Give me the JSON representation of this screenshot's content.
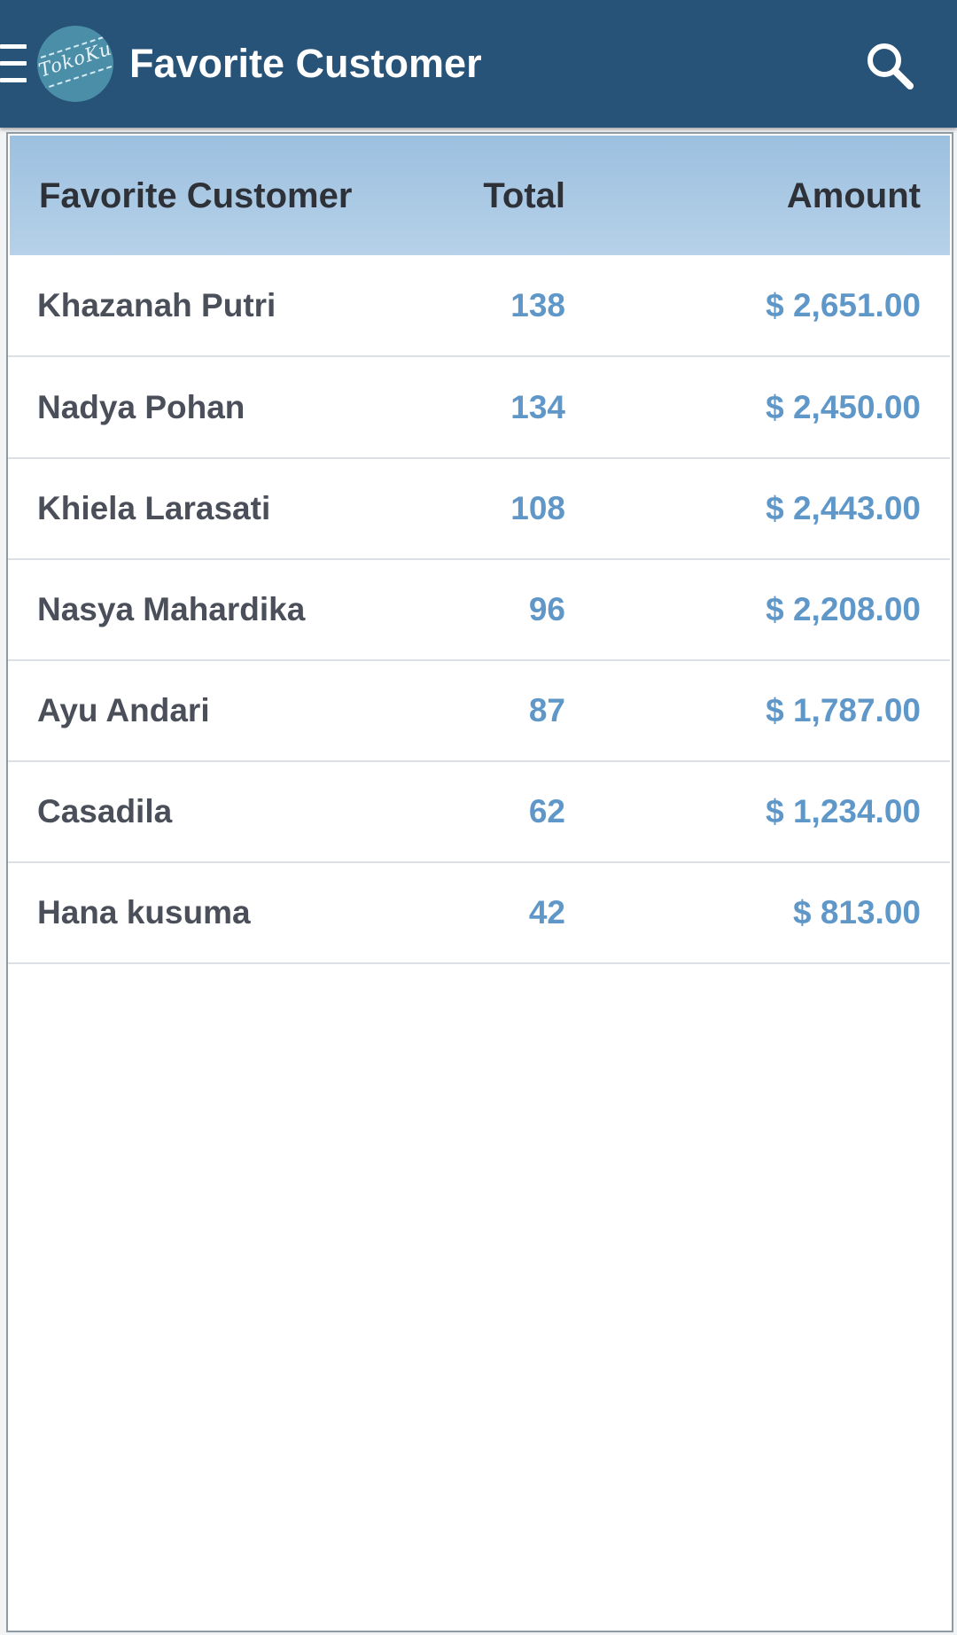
{
  "appbar": {
    "title": "Favorite Customer",
    "logo_text": "TokoKu",
    "icons": {
      "menu": "menu-icon",
      "search": "search-icon"
    }
  },
  "table": {
    "headers": {
      "name": "Favorite Customer",
      "total": "Total",
      "amount": "Amount"
    },
    "rows": [
      {
        "name": "Khazanah Putri",
        "total": "138",
        "amount": "$ 2,651.00"
      },
      {
        "name": "Nadya Pohan",
        "total": "134",
        "amount": "$ 2,450.00"
      },
      {
        "name": "Khiela Larasati",
        "total": "108",
        "amount": "$ 2,443.00"
      },
      {
        "name": "Nasya Mahardika",
        "total": "96",
        "amount": "$ 2,208.00"
      },
      {
        "name": "Ayu Andari",
        "total": "87",
        "amount": "$ 1,787.00"
      },
      {
        "name": "Casadila",
        "total": "62",
        "amount": "$ 1,234.00"
      },
      {
        "name": "Hana kusuma",
        "total": "42",
        "amount": "$ 813.00"
      }
    ]
  },
  "colors": {
    "appbar": "#285378",
    "header_gradient_top": "#9cc0e0",
    "header_gradient_bottom": "#b6d1e8",
    "value_text": "#5f97c8",
    "name_text": "#4a4f5a"
  }
}
